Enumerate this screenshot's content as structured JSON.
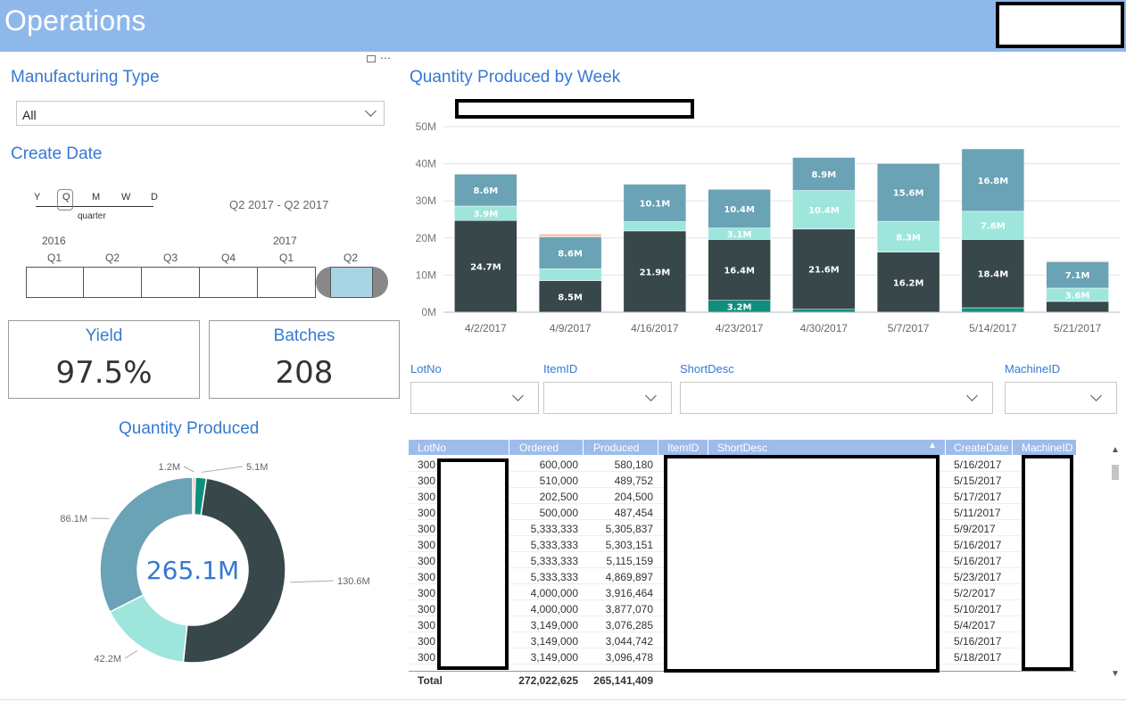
{
  "header": {
    "title": "Operations"
  },
  "manufacturing_type": {
    "title": "Manufacturing Type",
    "value": "All"
  },
  "create_date": {
    "title": "Create Date",
    "granularity": [
      "Y",
      "Q",
      "M",
      "W",
      "D"
    ],
    "granularity_selected": "Q",
    "granularity_label": "quarter",
    "range_text": "Q2 2017 - Q2 2017",
    "years": [
      "2016",
      "2017"
    ],
    "quarters": [
      "Q1",
      "Q2",
      "Q3",
      "Q4",
      "Q1",
      "Q2"
    ]
  },
  "kpi": {
    "yield": {
      "label": "Yield",
      "value": "97.5%"
    },
    "batches": {
      "label": "Batches",
      "value": "208"
    }
  },
  "donut": {
    "title": "Quantity Produced",
    "total": "265.1M",
    "labels": [
      "1.2M",
      "5.1M",
      "130.6M",
      "42.2M",
      "86.1M"
    ]
  },
  "bar_chart": {
    "title": "Quantity Produced by Week"
  },
  "filters": {
    "lotno": "LotNo",
    "itemid": "ItemID",
    "shortdesc": "ShortDesc",
    "machineid": "MachineID"
  },
  "table": {
    "headers": [
      "LotNo",
      "Ordered",
      "Produced",
      "ItemID",
      "ShortDesc",
      "CreateDate",
      "MachineID"
    ],
    "rows": [
      {
        "lot": "300",
        "ordered": "600,000",
        "produced": "580,180",
        "date": "5/16/2017"
      },
      {
        "lot": "300",
        "ordered": "510,000",
        "produced": "489,752",
        "date": "5/15/2017"
      },
      {
        "lot": "300",
        "ordered": "202,500",
        "produced": "204,500",
        "date": "5/17/2017"
      },
      {
        "lot": "300",
        "ordered": "500,000",
        "produced": "487,454",
        "date": "5/11/2017"
      },
      {
        "lot": "300",
        "ordered": "5,333,333",
        "produced": "5,305,837",
        "date": "5/9/2017"
      },
      {
        "lot": "300",
        "ordered": "5,333,333",
        "produced": "5,303,151",
        "date": "5/16/2017"
      },
      {
        "lot": "300",
        "ordered": "5,333,333",
        "produced": "5,115,159",
        "date": "5/16/2017"
      },
      {
        "lot": "300",
        "ordered": "5,333,333",
        "produced": "4,869,897",
        "date": "5/23/2017"
      },
      {
        "lot": "300",
        "ordered": "4,000,000",
        "produced": "3,916,464",
        "date": "5/2/2017"
      },
      {
        "lot": "300",
        "ordered": "4,000,000",
        "produced": "3,877,070",
        "date": "5/10/2017"
      },
      {
        "lot": "300",
        "ordered": "3,149,000",
        "produced": "3,076,285",
        "date": "5/4/2017"
      },
      {
        "lot": "300",
        "ordered": "3,149,000",
        "produced": "3,044,742",
        "date": "5/16/2017"
      },
      {
        "lot": "300",
        "ordered": "3,149,000",
        "produced": "3,096,478",
        "date": "5/18/2017"
      }
    ],
    "total": {
      "label": "Total",
      "ordered": "272,022,625",
      "produced": "265,141,409"
    }
  },
  "chart_data": {
    "type": "bar",
    "stacked": true,
    "title": "Quantity Produced by Week",
    "categories": [
      "4/2/2017",
      "4/9/2017",
      "4/16/2017",
      "4/23/2017",
      "4/30/2017",
      "5/7/2017",
      "5/14/2017",
      "5/21/2017"
    ],
    "ylim": [
      0,
      50
    ],
    "yticks": [
      "0M",
      "10M",
      "20M",
      "30M",
      "40M",
      "50M"
    ],
    "series": [
      {
        "color": "#0e8f7e",
        "values": [
          0,
          0,
          0,
          3.2,
          0.8,
          0,
          1.2,
          0
        ],
        "labels": [
          "",
          "",
          "",
          "3.2M",
          "",
          "",
          "",
          ""
        ]
      },
      {
        "color": "#37474a",
        "values": [
          24.7,
          8.5,
          21.9,
          16.4,
          21.6,
          16.2,
          18.4,
          2.9
        ],
        "labels": [
          "24.7M",
          "8.5M",
          "21.9M",
          "16.4M",
          "21.6M",
          "16.2M",
          "18.4M",
          ""
        ]
      },
      {
        "color": "#9ee6dc",
        "values": [
          3.9,
          3.2,
          2.5,
          3.1,
          10.4,
          8.3,
          7.6,
          3.6
        ],
        "labels": [
          "3.9M",
          "",
          "",
          "3.1M",
          "10.4M",
          "8.3M",
          "7.6M",
          "3.6M"
        ]
      },
      {
        "color": "#6aa2b6",
        "values": [
          8.6,
          8.6,
          10.1,
          10.4,
          8.9,
          15.6,
          16.8,
          7.1
        ],
        "labels": [
          "8.6M",
          "8.6M",
          "10.1M",
          "10.4M",
          "8.9M",
          "15.6M",
          "16.8M",
          "7.1M"
        ]
      },
      {
        "color": "#f6c6b4",
        "values": [
          0,
          0.8,
          0,
          0,
          0,
          0,
          0,
          0.3
        ],
        "labels": [
          "",
          "",
          "",
          "",
          "",
          "",
          "",
          ""
        ]
      }
    ],
    "grid": true,
    "donut": {
      "type": "pie",
      "total": "265.1M",
      "slices": [
        {
          "value": 1.2,
          "label": "1.2M",
          "color": "#f0ad8a"
        },
        {
          "value": 5.1,
          "label": "5.1M",
          "color": "#0e8f7e"
        },
        {
          "value": 130.6,
          "label": "130.6M",
          "color": "#37474a"
        },
        {
          "value": 42.2,
          "label": "42.2M",
          "color": "#9ee6dc"
        },
        {
          "value": 86.1,
          "label": "86.1M",
          "color": "#6aa2b6"
        }
      ]
    }
  }
}
